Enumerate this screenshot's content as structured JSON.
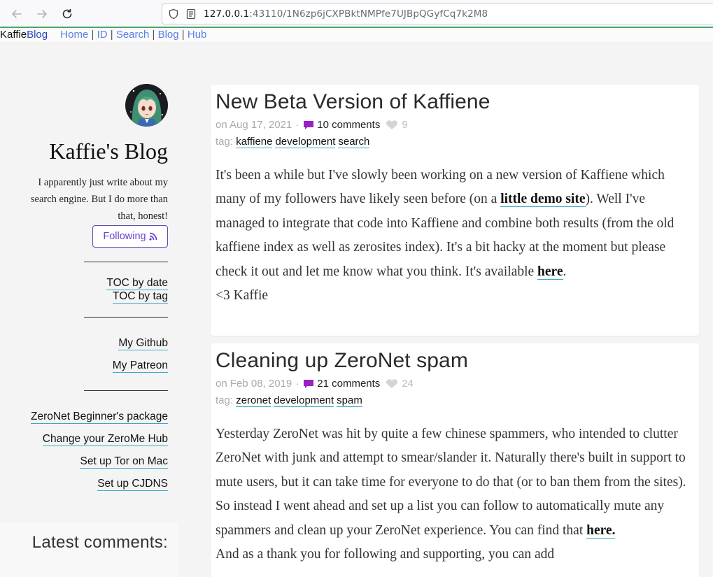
{
  "browser": {
    "url_host": "127.0.0.1",
    "url_rest": ":43110/1N6zp6jCXPBktNMPfe7UJBpQGyfCq7k2M8"
  },
  "topbar": {
    "brand_a": "Kaffie",
    "brand_b": "Blog",
    "links": [
      "Home",
      "ID",
      "Search",
      "Blog",
      "Hub"
    ],
    "separator": "|"
  },
  "sidebar": {
    "title": "Kaffie's Blog",
    "description": "I apparently just write about my search engine. But I do more than that, honest!",
    "follow_label": "Following",
    "toc_links": [
      "TOC by date",
      "TOC by tag"
    ],
    "personal_links": [
      "My Github",
      "My Patreon"
    ],
    "zeronet_links": [
      "ZeroNet Beginner's package",
      "Change your ZeroMe Hub",
      "Set up Tor on Mac",
      "Set up CJDNS"
    ],
    "latest_comments_title": "Latest comments:"
  },
  "posts": [
    {
      "title": "New Beta Version of Kaffiene",
      "date": "on Aug 17, 2021",
      "sep": "·",
      "comments": "10 comments",
      "likes": "9",
      "tag_label": "tag:",
      "tags": [
        "kaffiene",
        "development",
        "search"
      ],
      "body_1": "It's been a while but I've slowly been working on a new version of Kaffiene which many of my followers have likely seen before (on a ",
      "link_1": "little demo site",
      "body_2": "). Well I've managed to integrate that code into Kaffiene and combine both results (from the old kaffiene index as well as zerosites index). It's a bit hacky at the moment but please check it out and let me know what you think. It's available ",
      "link_2": "here",
      "body_3": ".",
      "signoff": "<3 Kaffie"
    },
    {
      "title": "Cleaning up ZeroNet spam",
      "date": "on Feb 08, 2019",
      "sep": "·",
      "comments": "21 comments",
      "likes": "24",
      "tag_label": "tag:",
      "tags": [
        "zeronet",
        "development",
        "spam"
      ],
      "body_1": "Yesterday ZeroNet was hit by quite a few chinese spammers, who intended to clutter ZeroNet with junk and attempt to smear/slander it. Naturally there's built in support to mute users, but it can take time for everyone to do that (or to ban them from the sites).",
      "body_2": "So instead I went ahead and set up a list you can follow to automatically mute any spammers and clean up your ZeroNet experience. You can find that ",
      "link_1": "here.",
      "body_3": "And as a thank you for following and supporting, you can add"
    }
  ],
  "colors": {
    "accent_green": "#45a86c",
    "link_blue": "#5a7ee6",
    "follow_purple": "#6a3fd0",
    "comment_icon": "#9c1fc4",
    "underline": "#3aa9c9"
  }
}
